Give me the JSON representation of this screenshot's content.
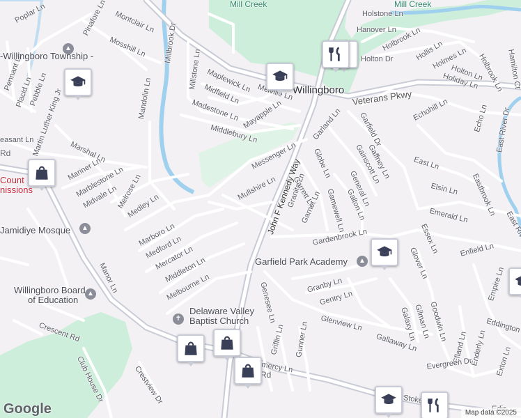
{
  "attribution": "Map data ©2025",
  "logo": "Google",
  "colors": {
    "road": "#ffffff",
    "arterial": "#c9ccd6",
    "park": "#cdeedb",
    "water": "#9fd0ee",
    "pin_icon": "#3a3f58"
  },
  "labels": {
    "streets": [
      "Mill Creek",
      "Mill Creek",
      "Holstone Ln",
      "Hanover Ln",
      "Holbrook Ln",
      "Hollis Ln",
      "Holmes Ln",
      "Holton Ln",
      "Holiday Ln",
      "Holbrook Ln",
      "Hamilton Ct",
      "Poplar Ln",
      "Pinafore Ln",
      "Montclair Ln",
      "Mosshill Ln",
      "Millbrook Dr",
      "Millstone Ln",
      "Maplewick Ln",
      "Midfield Ln",
      "Madestone Ln",
      "Mayapple Ln",
      "Middlebury Ln",
      "Melville Ln",
      "Veterans Pkwy",
      "Echohill Ln",
      "Echo Ln",
      "East River Dr",
      "Garfield Dr",
      "Garland Ln",
      "Gaffney Ln",
      "Gainscott Ln",
      "East Ln",
      "Elsin Ln",
      "Eastbrook Ln",
      "Emerald Ln",
      "Essex Ln",
      "Enfield Ln",
      "East Riv",
      "Messenger Ln",
      "Mullshire Ln",
      "John F Kennedy Way",
      "Granite Ln",
      "Garrett Ln",
      "Globe Ln",
      "General Ln",
      "Galton Ln",
      "Garnet Ln",
      "Gamewell Ln",
      "Gardenbrook Ln",
      "Glover Ln",
      "Genesee Ln",
      "Granby Ln",
      "Gentry Ln",
      "Glenview Ln",
      "Galaxy Ln",
      "Gilman Ln",
      "Goodwin Ln",
      "Gallaway Ln",
      "Efland Ln",
      "Enderly Ln",
      "Empire Ln",
      "Eddington",
      "Exton Ln",
      "Evergreen Dr",
      "Stokes Rd",
      "Edis",
      "Griffin Ln",
      "Gunner Ln",
      "Gomercy Ln",
      "Rd",
      "Pennant Ln",
      "Placid Ln",
      "Pebble Ln",
      "Martin Luther King Jr",
      "Marshal Ln",
      "Mariner Ln",
      "Marblestone Ln",
      "Midvale Ln",
      "Melrose Ln",
      "Medley Ln",
      "Mandolin Ln",
      "Marboro Ln",
      "Medford Ln",
      "Mercator Ln",
      "Middleton Ln",
      "Melbourne Ln",
      "Manor Ln",
      "Crescent Rd",
      "Club House Dr",
      "Crestview Dr",
      "easant Ln",
      "Rd",
      "Holton Dr"
    ],
    "places": {
      "town": "Willingboro",
      "township": "-Willingboro Township -",
      "mosque": "Jamidiye Mosque",
      "academy": "Garfield Park Academy",
      "board_line1": "Willingboro Board",
      "board_line2": "of Education",
      "church_line1": "Delaware Valley",
      "church_line2": "Baptist Church",
      "county_line1": "Count",
      "county_line2": "nissions"
    }
  },
  "markers": [
    {
      "type": "school-icon"
    },
    {
      "type": "school-icon"
    },
    {
      "type": "school-icon"
    },
    {
      "type": "school-icon"
    },
    {
      "type": "restaurant-icon"
    },
    {
      "type": "restaurant-icon"
    },
    {
      "type": "shopping-bag-icon"
    },
    {
      "type": "shopping-bag-icon"
    },
    {
      "type": "shopping-bag-icon"
    },
    {
      "type": "shopping-bag-icon"
    },
    {
      "type": "school-icon"
    },
    {
      "type": "restaurant-icon"
    }
  ]
}
